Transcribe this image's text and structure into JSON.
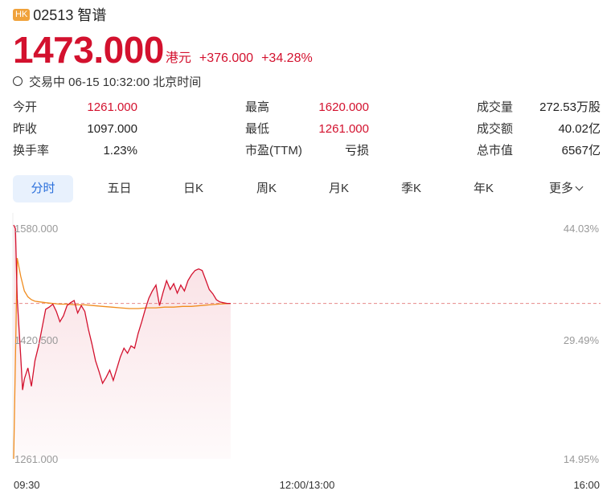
{
  "header": {
    "badge": "HK",
    "code_name": "02513 智谱"
  },
  "quote": {
    "price": "1473.000",
    "currency": "港元",
    "change": "+376.000",
    "change_pct": "+34.28%"
  },
  "status": "交易中 06-15 10:32:00 北京时间",
  "stats": {
    "open": {
      "label": "今开",
      "value": "1261.000"
    },
    "prev_close": {
      "label": "昨收",
      "value": "1097.000"
    },
    "turnover_rate": {
      "label": "换手率",
      "value": "1.23%"
    },
    "high": {
      "label": "最高",
      "value": "1620.000"
    },
    "low": {
      "label": "最低",
      "value": "1261.000"
    },
    "pe": {
      "label": "市盈(TTM)",
      "value": "亏损"
    },
    "volume": {
      "label": "成交量",
      "value": "272.53万股"
    },
    "amount": {
      "label": "成交额",
      "value": "40.02亿"
    },
    "market_cap": {
      "label": "总市值",
      "value": "6567亿"
    }
  },
  "tabs": {
    "t0": "分时",
    "t1": "五日",
    "t2": "日K",
    "t3": "周K",
    "t4": "月K",
    "t5": "季K",
    "t6": "年K",
    "t7": "更多"
  },
  "colors": {
    "up": "#d3112e",
    "avg_line": "#f08c1e",
    "accent": "#2a6fdb"
  },
  "chart_data": {
    "type": "line",
    "y_labels_left": [
      "1580.000",
      "1420.500",
      "1261.000"
    ],
    "y_labels_right": [
      "44.03%",
      "29.49%",
      "14.95%"
    ],
    "x_labels": [
      "09:30",
      "12:00/13:00",
      "16:00"
    ],
    "ylim": [
      1261.0,
      1580.0
    ],
    "prev_close_ref": 1473.0,
    "x_range_minutes": [
      0,
      330
    ],
    "series": [
      {
        "x": [
          0,
          1,
          2,
          4,
          5,
          6,
          8,
          10,
          12,
          14,
          16,
          18,
          20,
          22,
          24,
          26,
          28,
          30,
          32,
          34,
          36,
          38,
          40,
          42,
          44,
          46,
          48,
          50,
          52,
          54,
          56,
          58,
          60,
          62,
          64,
          66,
          68,
          70,
          72,
          74,
          76,
          78,
          80,
          82,
          84,
          86,
          88,
          90,
          92,
          94,
          96,
          98,
          100,
          102,
          104,
          106,
          108,
          110,
          112,
          114,
          116,
          118,
          120,
          122
        ],
        "values": [
          1580,
          1575,
          1480,
          1400,
          1355,
          1370,
          1385,
          1360,
          1395,
          1415,
          1440,
          1465,
          1468,
          1472,
          1462,
          1448,
          1456,
          1470,
          1474,
          1477,
          1460,
          1470,
          1462,
          1438,
          1418,
          1395,
          1380,
          1364,
          1372,
          1382,
          1368,
          1384,
          1400,
          1412,
          1405,
          1415,
          1412,
          1432,
          1448,
          1465,
          1480,
          1490,
          1498,
          1470,
          1488,
          1504,
          1492,
          1500,
          1487,
          1498,
          1490,
          1504,
          1512,
          1518,
          1520,
          1518,
          1505,
          1492,
          1486,
          1478,
          1475,
          1474,
          1473,
          1473
        ]
      },
      {
        "x": [
          0,
          2,
          4,
          6,
          8,
          10,
          12,
          15,
          18,
          22,
          26,
          30,
          35,
          40,
          45,
          50,
          55,
          60,
          65,
          70,
          75,
          80,
          85,
          90,
          95,
          100,
          105,
          110,
          115,
          122
        ],
        "values": [
          1261,
          1535,
          1510,
          1490,
          1482,
          1478,
          1476,
          1475,
          1474,
          1473,
          1472,
          1472,
          1471,
          1471,
          1470,
          1469,
          1468,
          1467,
          1466,
          1466,
          1467,
          1467,
          1468,
          1468,
          1469,
          1469,
          1470,
          1471,
          1472,
          1473
        ]
      }
    ]
  }
}
